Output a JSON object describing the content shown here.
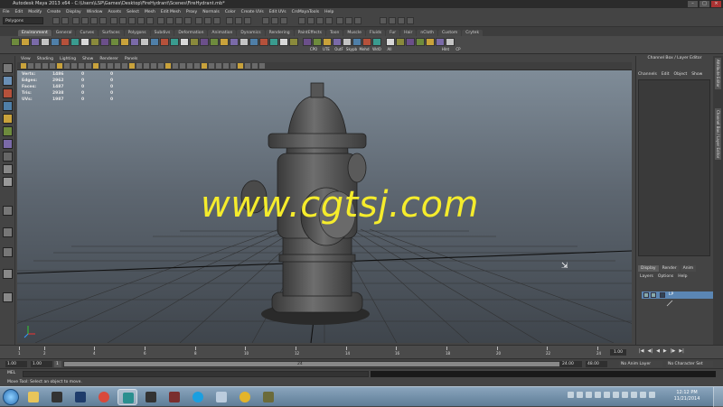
{
  "window": {
    "title": "Autodesk Maya 2013 x64 - C:\\Users\\LSP\\Games\\Desktop\\FireHydrant\\Scenes\\FireHydrant.mb*"
  },
  "menu": [
    "File",
    "Edit",
    "Modify",
    "Create",
    "Display",
    "Window",
    "Assets",
    "Select",
    "Mesh",
    "Edit Mesh",
    "Proxy",
    "Normals",
    "Color",
    "Create UVs",
    "Edit UVs",
    "CrsMayaTools",
    "Help"
  ],
  "status": {
    "mode": "Polygons"
  },
  "shelf_tabs": [
    "Environment",
    "General",
    "Curves",
    "Surfaces",
    "Polygons",
    "Subdivs",
    "Deformation",
    "Animation",
    "Dynamics",
    "Rendering",
    "PaintEffects",
    "Toon",
    "Muscle",
    "Fluids",
    "Fur",
    "Hair",
    "nCloth",
    "Custom",
    "Crytek"
  ],
  "shelf_active": "Environment",
  "shelf_labels": [
    "CPO",
    "UTE",
    "OutF",
    "Skypb",
    "Mehd",
    "WdO",
    "All",
    "Hlnt",
    "CP"
  ],
  "viewport_menu": [
    "View",
    "Shading",
    "Lighting",
    "Show",
    "Renderer",
    "Panels"
  ],
  "hud": [
    {
      "label": "Verts:",
      "a": "1486",
      "b": "0",
      "c": "0"
    },
    {
      "label": "Edges:",
      "a": "2962",
      "b": "0",
      "c": "0"
    },
    {
      "label": "Faces:",
      "a": "1487",
      "b": "0",
      "c": "0"
    },
    {
      "label": "Tris:",
      "a": "2938",
      "b": "0",
      "c": "0"
    },
    {
      "label": "UVs:",
      "a": "1987",
      "b": "0",
      "c": "0"
    }
  ],
  "watermark": "www.cgtsj.com",
  "right_panel": {
    "title": "Channel Box / Layer Editor",
    "menu": [
      "Channels",
      "Edit",
      "Object",
      "Show"
    ],
    "layer_tabs": [
      "Display",
      "Render",
      "Anim"
    ],
    "layer_menu": [
      "Layers",
      "Options",
      "Help"
    ],
    "layer_name": "LP"
  },
  "vertical_tabs": [
    "Attribute Editor",
    "Channel Box / Layer Editor"
  ],
  "timeline": {
    "ticks": [
      "1",
      "2",
      "4",
      "6",
      "8",
      "10",
      "12",
      "14",
      "16",
      "18",
      "20",
      "22",
      "24"
    ],
    "current_frame": "1.00"
  },
  "range": {
    "start": "1.00",
    "inner_start": "1.00",
    "handle": "1",
    "bar_label": "24",
    "end": "24.00",
    "anim_end": "48.00",
    "anim_layer": "No Anim Layer",
    "character_set": "No Character Set"
  },
  "command": {
    "label": "MEL"
  },
  "help_line": "Move Tool: Select an object to move.",
  "clock": {
    "time": "12:12 PM",
    "date": "11/21/2014"
  }
}
